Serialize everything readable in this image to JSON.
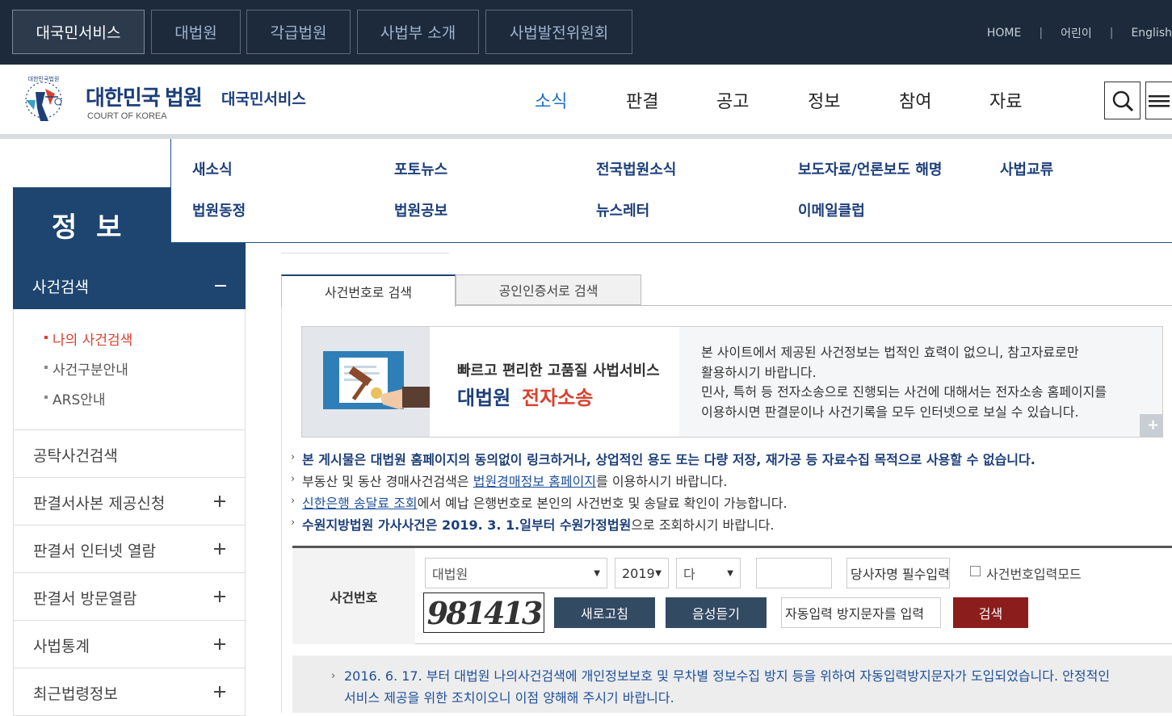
{
  "top_tabs": [
    "대국민서비스",
    "대법원",
    "각급법원",
    "사법부 소개",
    "사법발전위원회"
  ],
  "top_links": [
    "HOME",
    "어린이",
    "English"
  ],
  "logo": {
    "emblem_text": "대한민국법원",
    "title": "대한민국 법원",
    "subtitle": "COURT OF KOREA",
    "service": "대국민서비스"
  },
  "gnb": [
    "소식",
    "판결",
    "공고",
    "정보",
    "참여",
    "자료"
  ],
  "dropdown": [
    "새소식",
    "포토뉴스",
    "전국법원소식",
    "보도자료/언론보도 해명",
    "사법교류",
    "법원동정",
    "법원공보",
    "뉴스레터",
    "이메일클럽"
  ],
  "sidebar": {
    "title": "정 보",
    "active_label": "사건검색",
    "sub_items": [
      "나의 사건검색",
      "사건구분안내",
      "ARS안내"
    ],
    "items": [
      "공탁사건검색",
      "판결서사본 제공신청",
      "판결서 인터넷 열람",
      "판결서 방문열람",
      "사법통계",
      "최근법령정보"
    ]
  },
  "tabs": [
    "사건번호로 검색",
    "공인인증서로 검색"
  ],
  "banner": {
    "tagline": "빠르고 편리한 고품질 사법서비스",
    "main1": "대법원",
    "main2": "전자소송",
    "text1": "본 사이트에서 제공된 사건정보는 법적인 효력이 없으니, 참고자료로만",
    "text2": "활용하시기 바랍니다.",
    "text3": "민사, 특허 등 전자소송으로 진행되는 사건에 대해서는 전자소송 홈페이지를",
    "text4": "이용하시면 판결문이나 사건기록을 모두 인터넷으로 보실 수 있습니다.",
    "plus": "+"
  },
  "notices": {
    "n1": "본 게시물은 대법원 홈페이지의 동의없이 링크하거나, 상업적인 용도 또는 다량 저장, 재가공 등 자료수집 목적으로 사용할 수 없습니다.",
    "n2a": "부동산 및 동산 경매사건검색은 ",
    "n2link": "법원경매정보 홈페이지",
    "n2b": "를 이용하시기 바랍니다.",
    "n3link": "신한은행 송달료 조회",
    "n3b": "에서 예납 은행번호로 본인의 사건번호 및 송달료 확인이 가능합니다.",
    "n4a": "수원지방법원 가사사건은 2019. 3. 1.일부터 수원가정법원",
    "n4b": "으로 조회하시기 바랍니다."
  },
  "form": {
    "label": "사건번호",
    "court": "대법원",
    "year": "2019",
    "case_type": "다",
    "case_number": "",
    "party_placeholder": "당사자명 필수입력",
    "mode_label": "사건번호입력모드",
    "captcha": "981413",
    "refresh": "새로고침",
    "audio": "음성듣기",
    "captcha_placeholder": "자동입력 방지문자를 입력",
    "search": "검색"
  },
  "info": "2016. 6. 17. 부터 대법원 나의사건검색에 개인정보보호 및 무차별 정보수집 방지 등을 위하여 자동입력방지문자가 도입되었습니다. 안정적인 서비스 제공을 위한 조치이오니 이점 양해해 주시기 바랍니다."
}
